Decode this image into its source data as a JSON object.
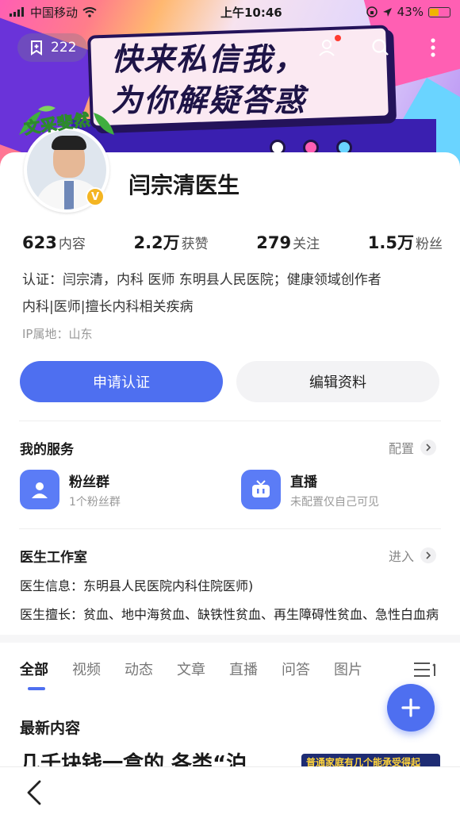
{
  "status_bar": {
    "carrier": "中国移动",
    "time": "上午10:46",
    "battery": "43%"
  },
  "header": {
    "collect_count": "222",
    "banner_headline_1": "快来私信我，",
    "banner_headline_2": "为你解疑答惑"
  },
  "profile": {
    "pendant_text": "文采斐然",
    "name": "闫宗清医生",
    "stats": [
      {
        "num": "623",
        "label": "内容"
      },
      {
        "num": "2.2万",
        "label": "获赞"
      },
      {
        "num": "279",
        "label": "关注"
      },
      {
        "num": "1.5万",
        "label": "粉丝"
      }
    ],
    "intro_line_1": "认证：闫宗清，内科 医师 东明县人民医院；健康领域创作者",
    "intro_line_2": "内科|医师|擅长内科相关疾病",
    "ip": "IP属地：山东"
  },
  "buttons": {
    "apply": "申请认证",
    "edit": "编辑资料"
  },
  "services": {
    "title": "我的服务",
    "config": "配置",
    "items": [
      {
        "name": "粉丝群",
        "desc": "1个粉丝群"
      },
      {
        "name": "直播",
        "desc": "未配置仅自己可见"
      }
    ]
  },
  "studio": {
    "title": "医生工作室",
    "enter": "进入",
    "info": "医生信息：东明县人民医院内科住院医师)",
    "specialty": "医生擅长：贫血、地中海贫血、缺铁性贫血、再生障碍性贫血、急性白血病"
  },
  "tabs": [
    "全部",
    "视频",
    "动态",
    "文章",
    "直播",
    "问答",
    "图片"
  ],
  "content": {
    "latest_title": "最新内容",
    "teaser": "几千块钱一盒的 各类“泊",
    "thumb_text": "普通家庭有几个能承受得起"
  },
  "colors": {
    "accent": "#4e6ff0",
    "badge": "#f4b522"
  }
}
